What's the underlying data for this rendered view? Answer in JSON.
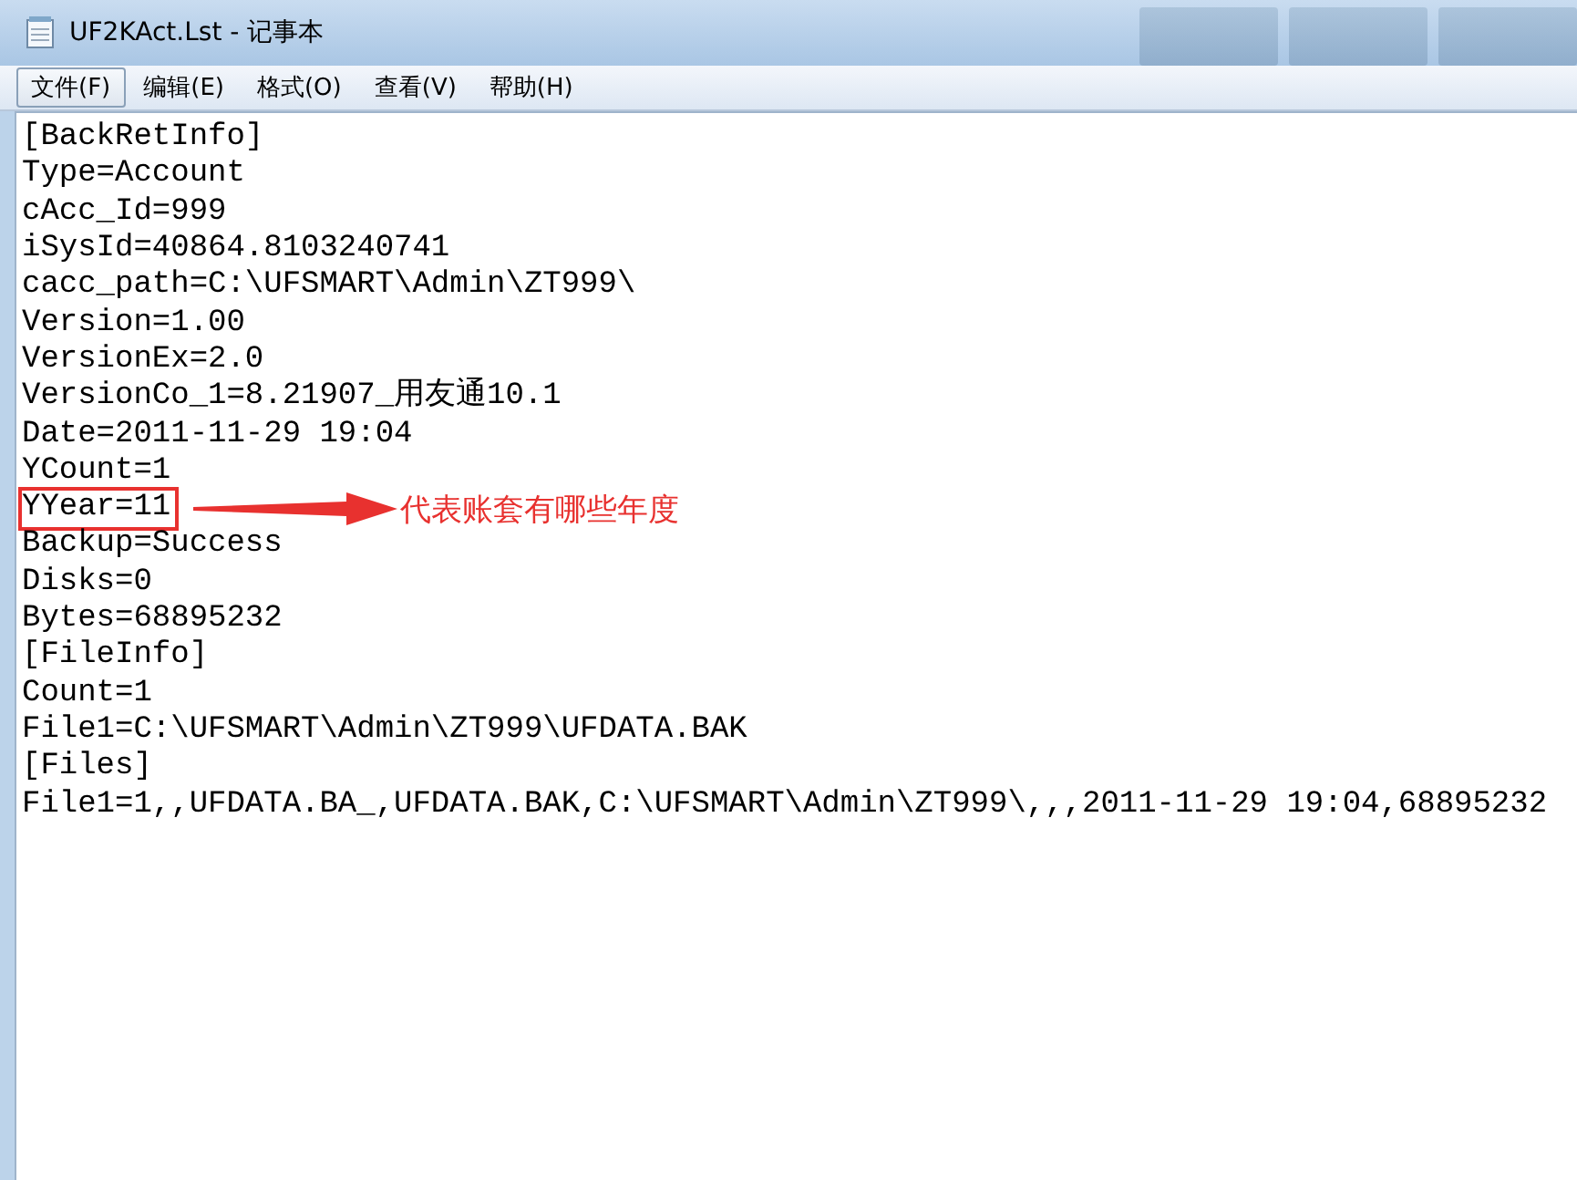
{
  "window": {
    "title": "UF2KAct.Lst - 记事本"
  },
  "menu": [
    {
      "label": "文件(F)",
      "selected": true
    },
    {
      "label": "编辑(E)",
      "selected": false
    },
    {
      "label": "格式(O)",
      "selected": false
    },
    {
      "label": "查看(V)",
      "selected": false
    },
    {
      "label": "帮助(H)",
      "selected": false
    }
  ],
  "lines": [
    {
      "text": "[BackRetInfo]",
      "boxed": false
    },
    {
      "text": "Type=Account",
      "boxed": false
    },
    {
      "text": "cAcc_Id=999",
      "boxed": false
    },
    {
      "text": "iSysId=40864.8103240741",
      "boxed": false
    },
    {
      "text": "cacc_path=C:\\UFSMART\\Admin\\ZT999\\",
      "boxed": false
    },
    {
      "text": "Version=1.00",
      "boxed": false
    },
    {
      "text": "VersionEx=2.0",
      "boxed": false
    },
    {
      "text": "VersionCo_1=8.21907_用友通10.1",
      "boxed": false
    },
    {
      "text": "Date=2011-11-29 19:04",
      "boxed": false
    },
    {
      "text": "YCount=1",
      "boxed": false
    },
    {
      "text": "YYear=11",
      "boxed": true,
      "note": "代表账套有哪些年度"
    },
    {
      "text": "Backup=Success",
      "boxed": false
    },
    {
      "text": "Disks=0",
      "boxed": false
    },
    {
      "text": "Bytes=68895232",
      "boxed": false
    },
    {
      "text": "[FileInfo]",
      "boxed": false
    },
    {
      "text": "Count=1",
      "boxed": false
    },
    {
      "text": "File1=C:\\UFSMART\\Admin\\ZT999\\UFDATA.BAK",
      "boxed": false
    },
    {
      "text": "[Files]",
      "boxed": false
    },
    {
      "text": "File1=1,,UFDATA.BA_,UFDATA.BAK,C:\\UFSMART\\Admin\\ZT999\\,,,2011-11-29 19:04,68895232",
      "boxed": false
    }
  ]
}
